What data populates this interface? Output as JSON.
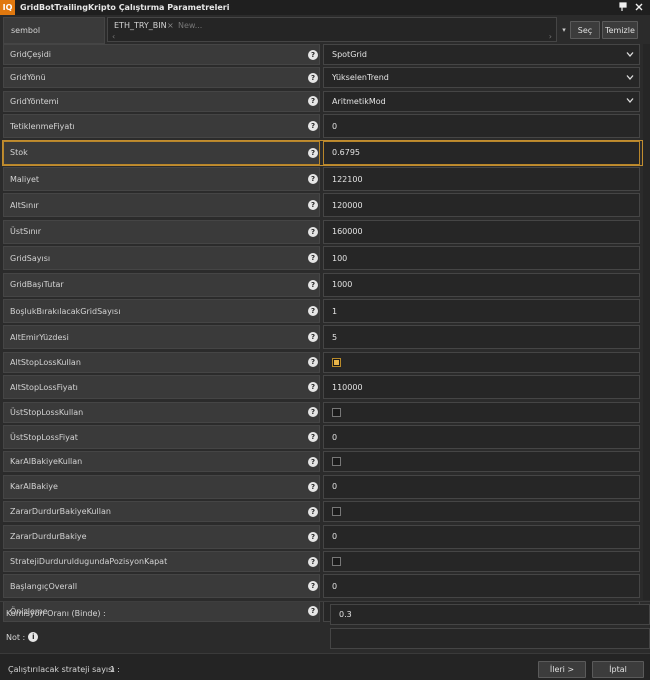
{
  "app": {
    "logo": "IQ",
    "title": "GridBotTrailingKripto Çalıştırma Parametreleri"
  },
  "titlebar_icons": [
    "pin-icon",
    "close-icon"
  ],
  "symbol": {
    "label": "sembol",
    "chip": "ETH_TRY_BIN",
    "chip_remove": "×",
    "placeholder": "New...",
    "dropdown": "▾",
    "select_label": "Seç",
    "clear_label": "Temizle"
  },
  "params": [
    {
      "label": "GridÇeşidi",
      "type": "select",
      "value": "SpotGrid"
    },
    {
      "label": "GridYönü",
      "type": "select",
      "value": "YükselenTrend"
    },
    {
      "label": "GridYöntemi",
      "type": "select",
      "value": "AritmetikMod"
    },
    {
      "label": "TetiklenmeFiyatı",
      "type": "text",
      "value": "0"
    },
    {
      "label": "Stok",
      "type": "text",
      "value": "0.6795",
      "highlighted": true
    },
    {
      "label": "Maliyet",
      "type": "text",
      "value": "122100"
    },
    {
      "label": "AltSınır",
      "type": "text",
      "value": "120000"
    },
    {
      "label": "ÜstSınır",
      "type": "text",
      "value": "160000"
    },
    {
      "label": "GridSayısı",
      "type": "text",
      "value": "100"
    },
    {
      "label": "GridBaşıTutar",
      "type": "text",
      "value": "1000"
    },
    {
      "label": "BoşlukBırakılacakGridSayısı",
      "type": "text",
      "value": "1"
    },
    {
      "label": "AltEmirYüzdesi",
      "type": "text",
      "value": "5"
    },
    {
      "label": "AltStopLossKullan",
      "type": "checkbox",
      "checked": true
    },
    {
      "label": "AltStopLossFiyatı",
      "type": "text",
      "value": "110000"
    },
    {
      "label": "ÜstStopLossKullan",
      "type": "checkbox",
      "checked": false
    },
    {
      "label": "ÜstStopLossFiyat",
      "type": "text",
      "value": "0"
    },
    {
      "label": "KarAlBakiyeKullan",
      "type": "checkbox",
      "checked": false
    },
    {
      "label": "KarAlBakiye",
      "type": "text",
      "value": "0"
    },
    {
      "label": "ZararDurdurBakiyeKullan",
      "type": "checkbox",
      "checked": false
    },
    {
      "label": "ZararDurdurBakiye",
      "type": "text",
      "value": "0"
    },
    {
      "label": "StratejiDurduruldugundaPozisyonKapat",
      "type": "checkbox",
      "checked": false
    },
    {
      "label": "BaşlangıçOverall",
      "type": "text",
      "value": "0"
    },
    {
      "label": "Önizleme",
      "type": "checkbox",
      "checked": true
    }
  ],
  "help_glyph": "?",
  "commission": {
    "label": "Komisyon Oranı (Binde) :",
    "value": "0.3"
  },
  "note": {
    "label": "Not :",
    "info_glyph": "i",
    "value": ""
  },
  "footer": {
    "count_label": "Çalıştırılacak strateji sayısı :",
    "count_value": "1",
    "next_label": "İleri >",
    "cancel_label": "İptal"
  },
  "colors": {
    "accent": "#e0780e",
    "highlight_border": "#c18d30",
    "checkbox_on": "#e8b54a"
  }
}
